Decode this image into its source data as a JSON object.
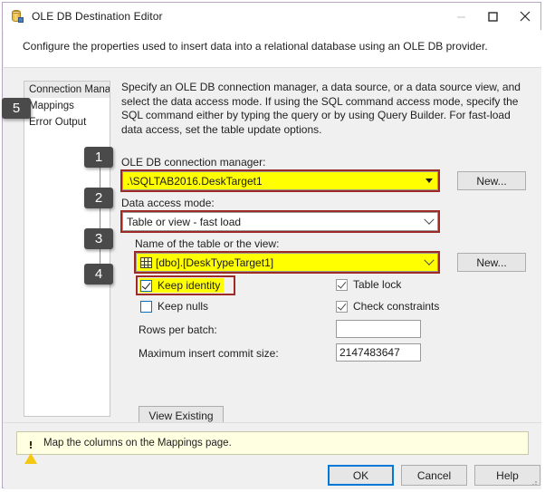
{
  "window": {
    "title": "OLE DB Destination Editor",
    "icon": "database-icon",
    "controls": {
      "minimize": "minimize-icon",
      "maximize": "maximize-icon",
      "close": "close-icon"
    }
  },
  "header": {
    "description": "Configure the properties used to insert data into a relational database using an OLE DB provider."
  },
  "sidebar": {
    "items": [
      {
        "label": "Connection Manager",
        "selected": true,
        "highlighted": false
      },
      {
        "label": "Mappings",
        "selected": false,
        "highlighted": true
      },
      {
        "label": "Error Output",
        "selected": false,
        "highlighted": false
      }
    ]
  },
  "main": {
    "instructions": "Specify an OLE DB connection manager, a data source, or a data source view, and select the data access mode. If using the SQL command access mode, specify the SQL command either by typing the query or by using Query Builder. For fast-load data access, set the table update options.",
    "connection_manager": {
      "label": "OLE DB connection manager:",
      "value": ".\\SQLTAB2016.DeskTarget1",
      "new_button": "New...",
      "highlighted": true
    },
    "data_access_mode": {
      "label": "Data access mode:",
      "value": "Table or view - fast load",
      "highlighted": true
    },
    "table_or_view": {
      "label": "Name of the table or the view:",
      "value": "[dbo].[DeskTypeTarget1]",
      "icon": "table-grid-icon",
      "new_button": "New...",
      "highlighted": true
    },
    "checkboxes": [
      {
        "label": "Keep identity",
        "checked": true,
        "enabled": true,
        "highlighted": true
      },
      {
        "label": "Keep nulls",
        "checked": false,
        "enabled": true,
        "highlighted": false
      },
      {
        "label": "Table lock",
        "checked": true,
        "enabled": false,
        "highlighted": false
      },
      {
        "label": "Check constraints",
        "checked": true,
        "enabled": false,
        "highlighted": false
      }
    ],
    "rows_per_batch": {
      "label": "Rows per batch:",
      "value": "",
      "placeholder": ""
    },
    "max_insert_commit_size": {
      "label": "Maximum insert commit size:",
      "value": "2147483647",
      "placeholder": ""
    },
    "view_existing_button": "View Existing"
  },
  "footer": {
    "warning": {
      "icon": "warning-icon",
      "text": "Map the columns on the Mappings page."
    },
    "buttons": {
      "ok": "OK",
      "cancel": "Cancel",
      "help": "Help"
    }
  },
  "callouts": [
    {
      "number": "1",
      "target": "connection-manager-combo"
    },
    {
      "number": "2",
      "target": "data-access-mode-combo"
    },
    {
      "number": "3",
      "target": "table-or-view-combo"
    },
    {
      "number": "4",
      "target": "keep-identity-checkbox"
    },
    {
      "number": "5",
      "target": "sidebar-item-mappings"
    }
  ],
  "colors": {
    "highlight_yellow": "#ffff00",
    "callout_ring_red": "#9e2a25",
    "callout_badge_gray": "#4a4a4a",
    "accent_blue": "#0078d7",
    "warning_bg": "#ffffe1"
  }
}
